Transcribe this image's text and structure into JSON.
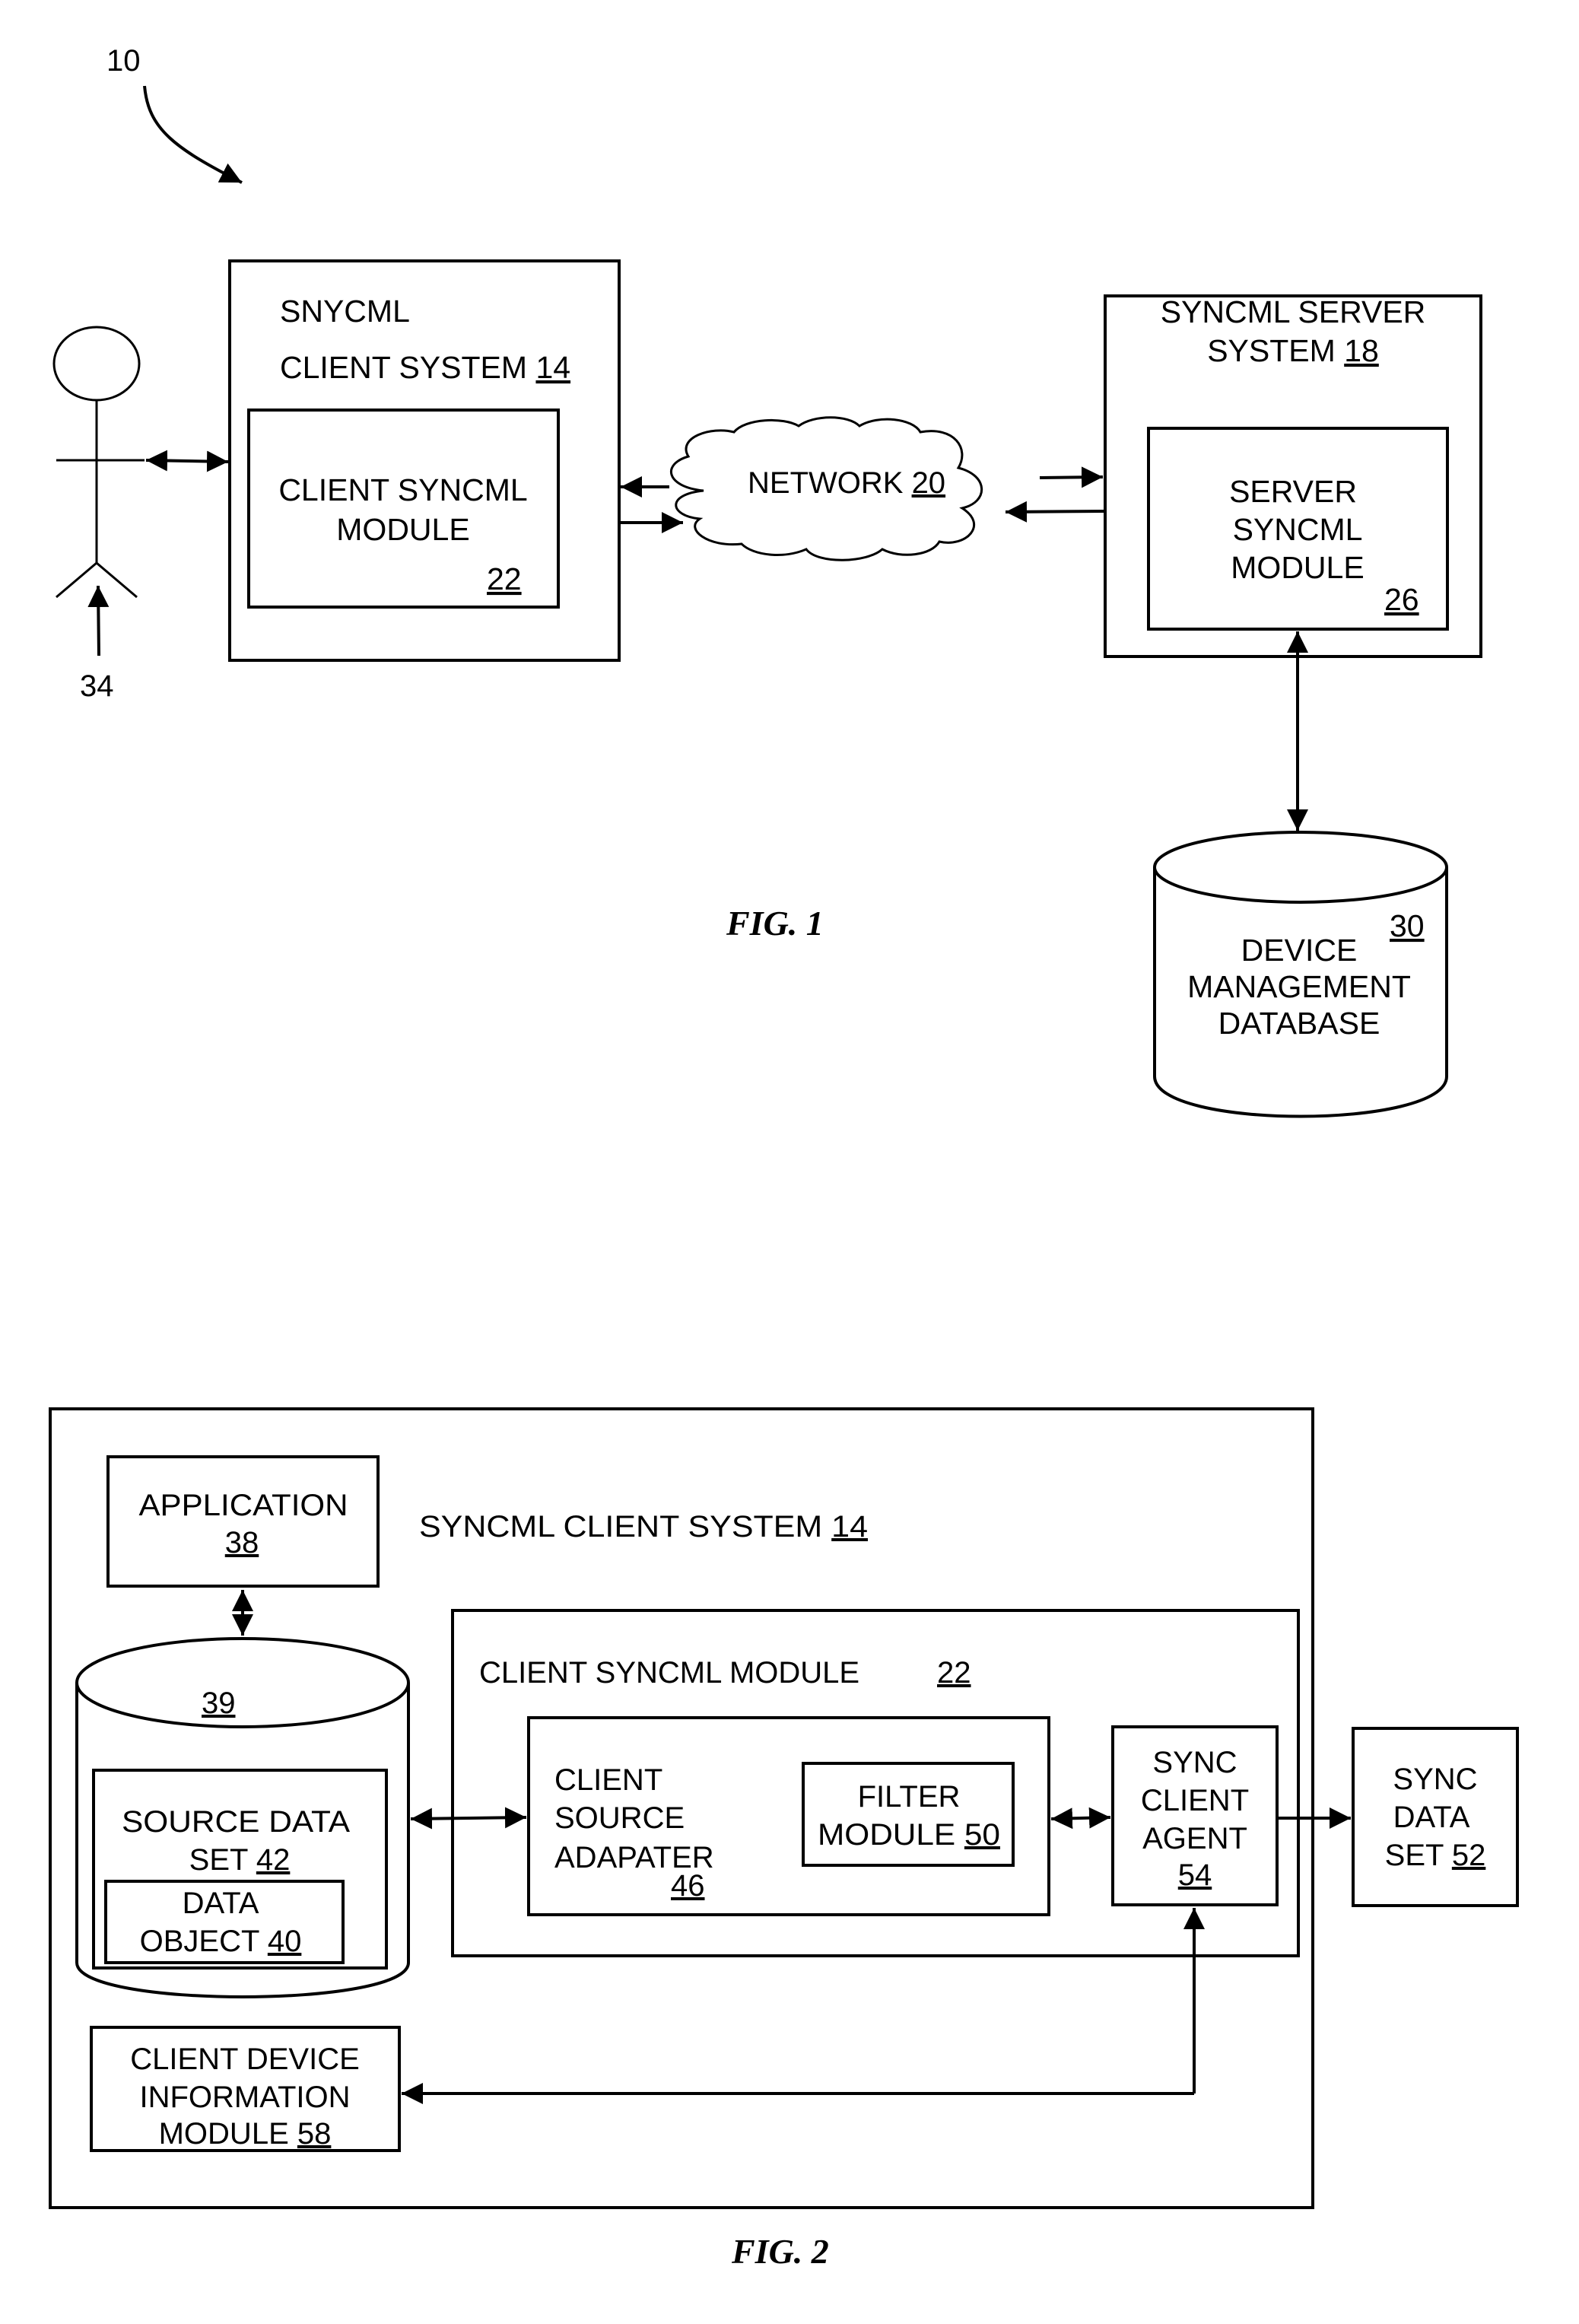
{
  "fig1": {
    "caption": "FIG. 1",
    "system_ref": "10",
    "user_ref": "34",
    "client_system": {
      "line1": "SNYCML",
      "line2": "CLIENT SYSTEM",
      "ref": "14"
    },
    "client_module": {
      "line1": "CLIENT SYNCML",
      "line2": "MODULE",
      "ref": "22"
    },
    "network": {
      "label": "NETWORK",
      "ref": "20"
    },
    "server_system": {
      "line1": "SYNCML SERVER",
      "line2": "SYSTEM",
      "ref": "18"
    },
    "server_module": {
      "line1": "SERVER",
      "line2": "SYNCML",
      "line3": "MODULE",
      "ref": "26"
    },
    "database": {
      "line1": "DEVICE",
      "line2": "MANAGEMENT",
      "line3": "DATABASE",
      "ref": "30"
    }
  },
  "fig2": {
    "caption": "FIG. 2",
    "client_system": {
      "label": "SYNCML CLIENT  SYSTEM",
      "ref": "14"
    },
    "application": {
      "label": "APPLICATION",
      "ref": "38"
    },
    "datastore": {
      "ref": "39"
    },
    "source_data_set": {
      "line1": "SOURCE DATA",
      "line2": "SET",
      "ref": "42"
    },
    "data_object": {
      "line1": "DATA",
      "line2": "OBJECT",
      "ref": "40"
    },
    "client_module": {
      "label": "CLIENT SYNCML MODULE",
      "ref": "22"
    },
    "source_adapter": {
      "line1": "CLIENT",
      "line2": "SOURCE",
      "line3": "ADAPATER",
      "ref": "46"
    },
    "filter_module": {
      "line1": "FILTER",
      "line2": "MODULE",
      "ref": "50"
    },
    "sync_agent": {
      "line1": "SYNC",
      "line2": "CLIENT",
      "line3": "AGENT",
      "ref": "54"
    },
    "sync_data_set": {
      "line1": "SYNC",
      "line2": "DATA",
      "line3": "SET",
      "ref": "52"
    },
    "device_info": {
      "line1": "CLIENT DEVICE",
      "line2": "INFORMATION",
      "line3": "MODULE",
      "ref": "58"
    }
  }
}
